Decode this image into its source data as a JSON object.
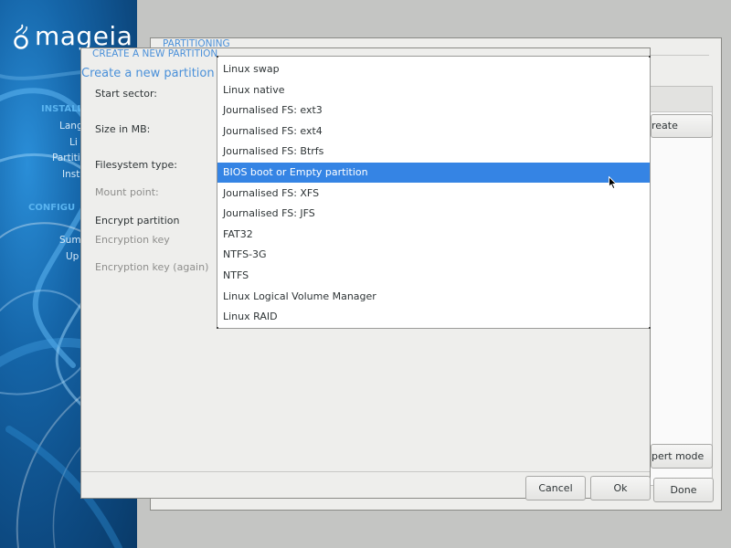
{
  "sidebar": {
    "logo_text": "mageia",
    "sections": [
      {
        "label": "INSTALL"
      },
      {
        "label": "CONFIGU"
      }
    ],
    "items": [
      {
        "label": "Lang"
      },
      {
        "label": "Li"
      },
      {
        "label": "Partiti"
      },
      {
        "label": "Inst"
      },
      {
        "label": "Sum"
      },
      {
        "label": "Up"
      }
    ]
  },
  "main_window": {
    "title": "PARTITIONING",
    "create_button": "reate",
    "expert_mode_button": "pert mode",
    "done_button": "Done"
  },
  "dialog": {
    "title": "CREATE A NEW PARTITION",
    "subtitle": "Create a new partition",
    "fields": {
      "start_sector": "Start sector:",
      "size_in_mb": "Size in MB:",
      "filesystem_type": "Filesystem type:",
      "mount_point": "Mount point:",
      "encrypt_partition": "Encrypt partition",
      "encryption_key": "Encryption key",
      "encryption_key_again": "Encryption key (again)"
    },
    "cancel_button": "Cancel",
    "ok_button": "Ok"
  },
  "filesystem_dropdown": {
    "selected": "BIOS boot or Empty partition",
    "options": [
      "Linux swap",
      "Linux native",
      "Journalised FS: ext3",
      "Journalised FS: ext4",
      "Journalised FS: Btrfs",
      "BIOS boot or Empty partition",
      "Journalised FS: XFS",
      "Journalised FS: JFS",
      "FAT32",
      "NTFS-3G",
      "NTFS",
      "Linux Logical Volume Manager",
      "Linux RAID"
    ]
  },
  "colors": {
    "accent": "#4a90d9",
    "selection": "#3584e4",
    "sidebar_blue": "#1565a8"
  },
  "icons": {
    "logo": "mageia-logo-icon",
    "cursor": "mouse-pointer-icon"
  }
}
